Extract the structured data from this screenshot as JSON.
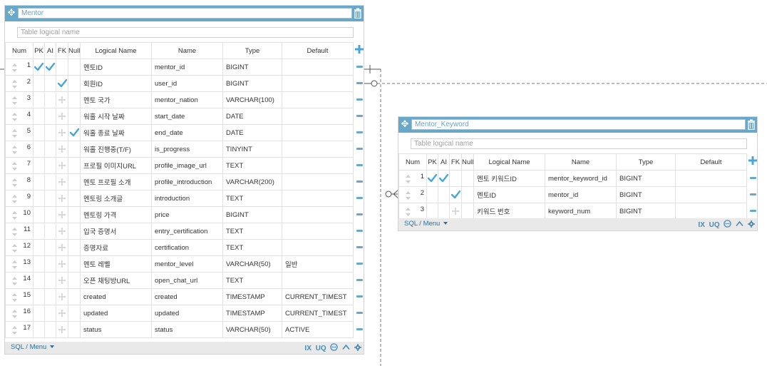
{
  "colors": {
    "header": "#6aa8c9",
    "check": "#4aa6d6",
    "accent": "#2f6f98"
  },
  "tables": [
    {
      "name": "Mentor",
      "logical_placeholder": "Table logical name",
      "headers": {
        "num": "Num",
        "pk": "PK",
        "ai": "AI",
        "fk": "FK",
        "null": "Null",
        "logical": "Logical Name",
        "name": "Name",
        "type": "Type",
        "default": "Default"
      },
      "rows": [
        {
          "num": "1",
          "pk": true,
          "ai": true,
          "fk": false,
          "null": false,
          "logical": "멘토ID",
          "name": "mentor_id",
          "type": "BIGINT",
          "default": ""
        },
        {
          "num": "2",
          "pk": false,
          "ai": false,
          "fk": true,
          "null": false,
          "logical": "회원ID",
          "name": "user_id",
          "type": "BIGINT",
          "default": ""
        },
        {
          "num": "3",
          "pk": false,
          "ai": false,
          "fk": false,
          "null": false,
          "logical": "멘토 국가",
          "name": "mentor_nation",
          "type": "VARCHAR(100)",
          "default": ""
        },
        {
          "num": "4",
          "pk": false,
          "ai": false,
          "fk": false,
          "null": false,
          "logical": "워홀 시작 날짜",
          "name": "start_date",
          "type": "DATE",
          "default": ""
        },
        {
          "num": "5",
          "pk": false,
          "ai": false,
          "fk": false,
          "null": true,
          "logical": "워홀 종료 날짜",
          "name": "end_date",
          "type": "DATE",
          "default": ""
        },
        {
          "num": "6",
          "pk": false,
          "ai": false,
          "fk": false,
          "null": false,
          "logical": "워홀 진행중(T/F)",
          "name": "is_progress",
          "type": "TINYINT",
          "default": ""
        },
        {
          "num": "7",
          "pk": false,
          "ai": false,
          "fk": false,
          "null": false,
          "logical": "프로필 이미지URL",
          "name": "profile_image_url",
          "type": "TEXT",
          "default": ""
        },
        {
          "num": "8",
          "pk": false,
          "ai": false,
          "fk": false,
          "null": false,
          "logical": "멘토 프로필 소개",
          "name": "profile_introduction",
          "type": "VARCHAR(200)",
          "default": ""
        },
        {
          "num": "9",
          "pk": false,
          "ai": false,
          "fk": false,
          "null": false,
          "logical": "멘토링 소개글",
          "name": "introduction",
          "type": "TEXT",
          "default": ""
        },
        {
          "num": "10",
          "pk": false,
          "ai": false,
          "fk": false,
          "null": false,
          "logical": "멘토링 가격",
          "name": "price",
          "type": "BIGINT",
          "default": ""
        },
        {
          "num": "11",
          "pk": false,
          "ai": false,
          "fk": false,
          "null": false,
          "logical": "입국 증명서",
          "name": "entry_certification",
          "type": "TEXT",
          "default": ""
        },
        {
          "num": "12",
          "pk": false,
          "ai": false,
          "fk": false,
          "null": false,
          "logical": "증명자료",
          "name": "certification",
          "type": "TEXT",
          "default": ""
        },
        {
          "num": "13",
          "pk": false,
          "ai": false,
          "fk": false,
          "null": false,
          "logical": "멘토 레벨",
          "name": "mentor_level",
          "type": "VARCHAR(50)",
          "default": "일반"
        },
        {
          "num": "14",
          "pk": false,
          "ai": false,
          "fk": false,
          "null": false,
          "logical": "오픈 채팅방URL",
          "name": "open_chat_url",
          "type": "TEXT",
          "default": ""
        },
        {
          "num": "15",
          "pk": false,
          "ai": false,
          "fk": false,
          "null": false,
          "logical": "created",
          "name": "created",
          "type": "TIMESTAMP",
          "default": "CURRENT_TIMEST"
        },
        {
          "num": "16",
          "pk": false,
          "ai": false,
          "fk": false,
          "null": false,
          "logical": "updated",
          "name": "updated",
          "type": "TIMESTAMP",
          "default": "CURRENT_TIMEST"
        },
        {
          "num": "17",
          "pk": false,
          "ai": false,
          "fk": false,
          "null": false,
          "logical": "status",
          "name": "status",
          "type": "VARCHAR(50)",
          "default": "ACTIVE"
        }
      ],
      "footer": {
        "sql_menu": "SQL / Menu",
        "ix": "IX",
        "uq": "UQ"
      }
    },
    {
      "name": "Mentor_Keyword",
      "logical_placeholder": "Table logical name",
      "headers": {
        "num": "Num",
        "pk": "PK",
        "ai": "AI",
        "fk": "FK",
        "null": "Null",
        "logical": "Logical Name",
        "name": "Name",
        "type": "Type",
        "default": "Default"
      },
      "rows": [
        {
          "num": "1",
          "pk": true,
          "ai": true,
          "fk": false,
          "null": false,
          "logical": "멘토 키워드ID",
          "name": "mentor_keyword_id",
          "type": "BIGINT",
          "default": ""
        },
        {
          "num": "2",
          "pk": false,
          "ai": false,
          "fk": true,
          "null": false,
          "logical": "멘토ID",
          "name": "mentor_id",
          "type": "BIGINT",
          "default": ""
        },
        {
          "num": "3",
          "pk": false,
          "ai": false,
          "fk": false,
          "null": false,
          "logical": "키워드 번호",
          "name": "keyword_num",
          "type": "BIGINT",
          "default": ""
        }
      ],
      "footer": {
        "sql_menu": "SQL / Menu",
        "ix": "IX",
        "uq": "UQ"
      }
    }
  ]
}
